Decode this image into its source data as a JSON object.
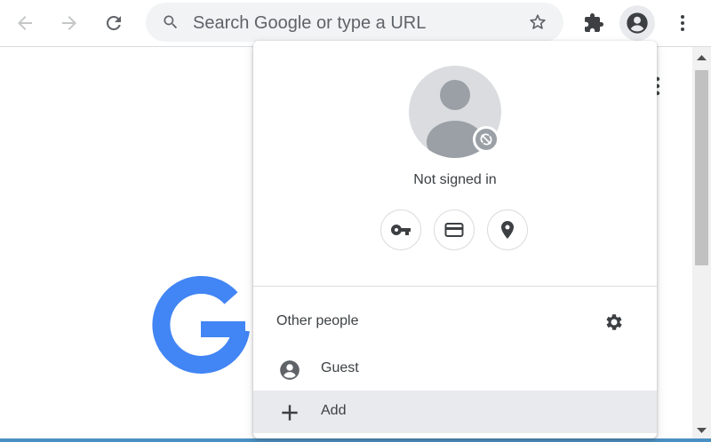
{
  "toolbar": {
    "back_icon": "arrow-left-icon",
    "forward_icon": "arrow-right-icon",
    "reload_icon": "reload-icon",
    "omnibox": {
      "placeholder": "Search Google or type a URL",
      "search_icon": "search-icon",
      "bookmark_icon": "star-icon"
    },
    "extensions_icon": "puzzle-icon",
    "profile_icon": "account-circle-icon",
    "menu_icon": "kebab-icon"
  },
  "profile_menu": {
    "status": "Not signed in",
    "avatar_icon": "person-icon",
    "sync_badge_icon": "sync-off-icon",
    "quick_actions": [
      {
        "icon": "key-icon"
      },
      {
        "icon": "credit-card-icon"
      },
      {
        "icon": "location-pin-icon"
      }
    ],
    "other_people": {
      "title": "Other people",
      "settings_icon": "gear-icon",
      "items": [
        {
          "label": "Guest",
          "icon": "account-circle-icon"
        },
        {
          "label": "Add",
          "icon": "plus-icon",
          "highlighted": true
        }
      ]
    }
  },
  "colors": {
    "google_blue": "#4285f4",
    "google_red": "#ea4335",
    "menu_hover": "#e8eaed",
    "icon_gray": "#5f6368"
  }
}
